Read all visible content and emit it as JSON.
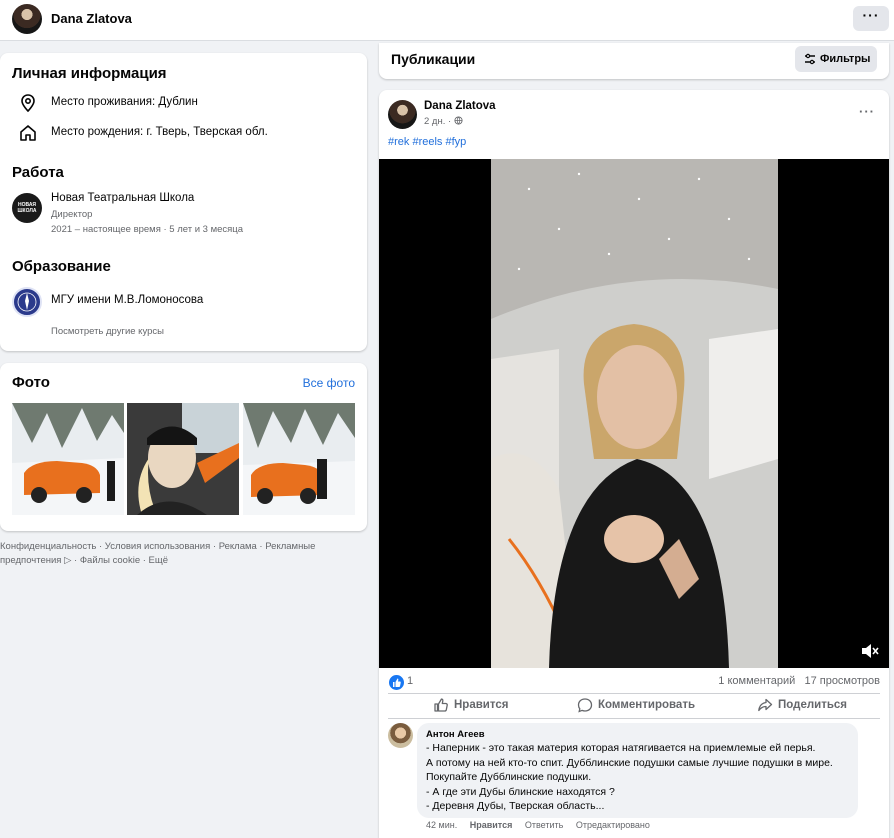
{
  "topbar": {
    "name": "Dana Zlatova",
    "more": "···"
  },
  "info": {
    "title": "Личная информация",
    "residence": "Место проживания: Дублин",
    "birthplace": "Место рождения: г. Тверь, Тверская обл.",
    "work_title": "Работа",
    "work": {
      "org": "Новая Театральная Школа",
      "role": "Директор",
      "period": "2021 – настоящее время · 5 лет и 3 месяца",
      "logo_text": "НОВАЯ ШКОЛА"
    },
    "education_title": "Образование",
    "education": {
      "school": "МГУ имени М.В.Ломоносова",
      "more_link": "Посмотреть другие курсы"
    }
  },
  "photos": {
    "title": "Фото",
    "all_link": "Все фото"
  },
  "footer": {
    "text": "Конфиденциальность · Условия использования · Реклама · Рекламные предпочтения ▷ · Файлы cookie · Ещё"
  },
  "publications": {
    "title": "Публикации",
    "filters": "Фильтры"
  },
  "post": {
    "author": "Dana Zlatova",
    "time": "2 дн. · ",
    "more": "···",
    "hashtags": "#rek #reels #fyp",
    "reactions_count": "1",
    "comments_views": "1 комментарий   17 просмотров",
    "actions": {
      "like": "Нравится",
      "comment": "Комментировать",
      "share": "Поделиться"
    }
  },
  "comment": {
    "author": "Антон Агеев",
    "text": "- Наперник - это такая материя которая натягивается на приемлемые ей перья.\nА потому на ней кто-то спит. Дубблинские подушки самые лучшие подушки в мире. Покупайте Дубблинские подушки.\n- А где эти Дубы блинские находятся ?\n- Деревня Дубы, Тверская область...",
    "time": "42 мин.",
    "like": "Нравится",
    "reply": "Ответить",
    "edited": "Отредактировано"
  },
  "colors": {
    "accent": "#1877f2",
    "link": "#216fdb",
    "background": "#f0f2f5",
    "muted": "#65676b"
  },
  "icons": [
    "location-icon",
    "home-icon",
    "filter-icon",
    "globe-icon",
    "like-icon",
    "comment-icon",
    "share-icon",
    "mute-icon"
  ]
}
